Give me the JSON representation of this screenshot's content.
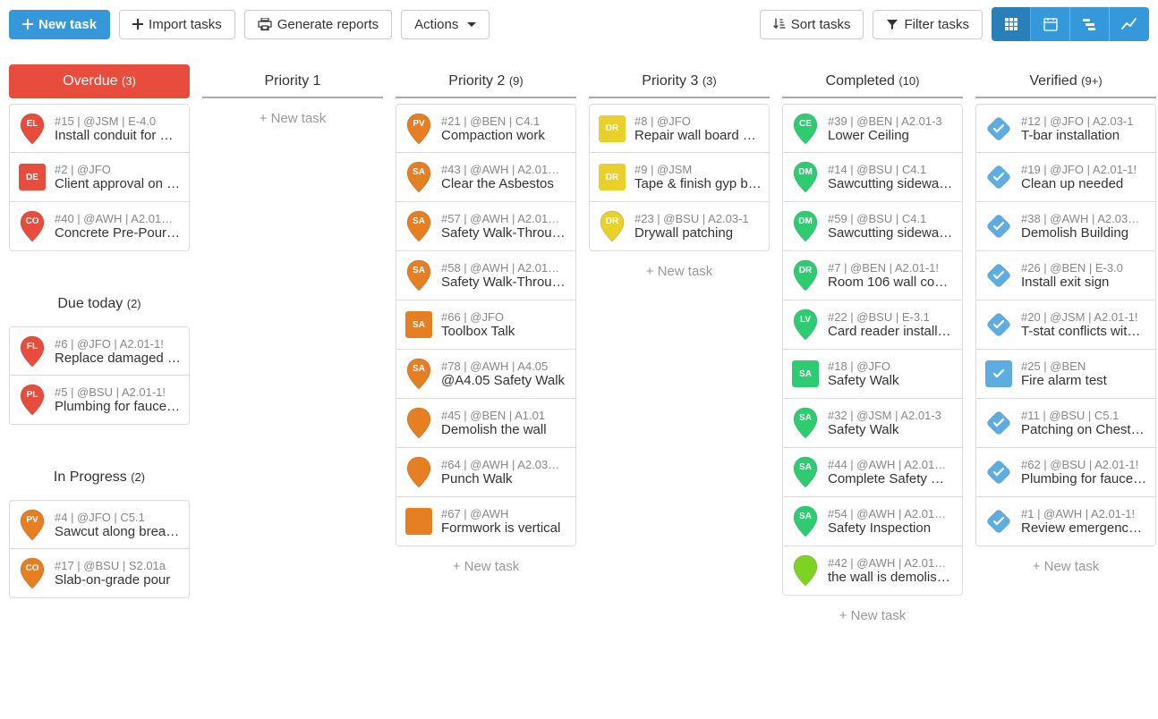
{
  "toolbar": {
    "new_task": "New task",
    "import_tasks": "Import tasks",
    "generate_reports": "Generate reports",
    "actions": "Actions",
    "sort_tasks": "Sort tasks",
    "filter_tasks": "Filter tasks"
  },
  "new_task_inline": "+ New task",
  "colors": {
    "red": "#e74c3c",
    "orange": "#e67e22",
    "yellow": "#e9d02b",
    "green": "#2ecc71",
    "lime": "#7ed321",
    "blue": "#5dade2",
    "blue2": "#5dade2"
  },
  "columns": [
    {
      "id": "overdue",
      "title": "Overdue",
      "count": "(3)",
      "header_style": "overdue",
      "groups": [
        {
          "cards": [
            {
              "shape": "pin",
              "color": "red",
              "badge": "EL",
              "meta": "#15 | @JSM | E-4.0",
              "title": "Install conduit for …"
            },
            {
              "shape": "square",
              "color": "red",
              "badge": "DE",
              "meta": "#2 | @JFO",
              "title": "Client approval on …"
            },
            {
              "shape": "pin",
              "color": "red",
              "badge": "CO",
              "meta": "#40 | @AWH | A2.01…",
              "title": "Concrete Pre-Pour…"
            }
          ]
        },
        {
          "title": "Due today",
          "count": "(2)",
          "cards": [
            {
              "shape": "pin",
              "color": "red",
              "badge": "FL",
              "meta": "#6 | @JFO | A2.01-1!",
              "title": "Replace damaged c…"
            },
            {
              "shape": "pin",
              "color": "red",
              "badge": "PL",
              "meta": "#5 | @BSU | A2.01-1!",
              "title": "Plumbing for fauce…"
            }
          ]
        },
        {
          "title": "In Progress",
          "count": "(2)",
          "cards": [
            {
              "shape": "pin",
              "color": "orange",
              "badge": "PV",
              "meta": "#4 | @JFO | C5.1",
              "title": "Sawcut along brea…"
            },
            {
              "shape": "pin",
              "color": "orange",
              "badge": "CO",
              "meta": "#17 | @BSU | S2.01a",
              "title": "Slab-on-grade pour"
            }
          ]
        }
      ]
    },
    {
      "id": "priority1",
      "title": "Priority 1",
      "count": "",
      "groups": [
        {
          "cards": []
        }
      ],
      "show_new_task_top": true
    },
    {
      "id": "priority2",
      "title": "Priority 2",
      "count": "(9)",
      "groups": [
        {
          "cards": [
            {
              "shape": "pin",
              "color": "orange",
              "badge": "PV",
              "meta": "#21 | @BEN | C4.1",
              "title": "Compaction work"
            },
            {
              "shape": "pin",
              "color": "orange",
              "badge": "SA",
              "meta": "#43 | @AWH | A2.01…",
              "title": "Clear the Asbestos"
            },
            {
              "shape": "pin",
              "color": "orange",
              "badge": "SA",
              "meta": "#57 | @AWH | A2.01…",
              "title": "Safety Walk-Throu…"
            },
            {
              "shape": "pin",
              "color": "orange",
              "badge": "SA",
              "meta": "#58 | @AWH | A2.01…",
              "title": "Safety Walk-Throu…"
            },
            {
              "shape": "square",
              "color": "orange",
              "badge": "SA",
              "meta": "#66 | @JFO",
              "title": "Toolbox Talk"
            },
            {
              "shape": "pin",
              "color": "orange",
              "badge": "SA",
              "meta": "#78 | @AWH | A4.05",
              "title": "@A4.05 Safety Walk"
            },
            {
              "shape": "pin",
              "color": "orange",
              "badge": "",
              "meta": "#45 | @BEN | A1.01",
              "title": "Demolish the wall"
            },
            {
              "shape": "pin",
              "color": "orange",
              "badge": "",
              "meta": "#64 | @AWH | A2.03…",
              "title": "Punch Walk"
            },
            {
              "shape": "square",
              "color": "orange",
              "badge": "",
              "meta": "#67 | @AWH",
              "title": "Formwork is vertical"
            }
          ]
        }
      ],
      "show_new_task_bottom": true
    },
    {
      "id": "priority3",
      "title": "Priority 3",
      "count": "(3)",
      "groups": [
        {
          "cards": [
            {
              "shape": "square",
              "color": "yellow",
              "badge": "DR",
              "meta": "#8 | @JFO",
              "title": "Repair wall board …"
            },
            {
              "shape": "square",
              "color": "yellow",
              "badge": "DR",
              "meta": "#9 | @JSM",
              "title": "Tape & finish gyp b…"
            },
            {
              "shape": "pin",
              "color": "yellow",
              "badge": "DR",
              "meta": "#23 | @BSU | A2.03-1",
              "title": "Drywall patching"
            }
          ]
        }
      ],
      "show_new_task_bottom": true
    },
    {
      "id": "completed",
      "title": "Completed",
      "count": "(10)",
      "groups": [
        {
          "cards": [
            {
              "shape": "pin",
              "color": "green",
              "badge": "CE",
              "meta": "#39 | @BEN | A2.01-3",
              "title": "Lower Ceiling"
            },
            {
              "shape": "pin",
              "color": "green",
              "badge": "DM",
              "meta": "#14 | @BSU | C4.1",
              "title": "Sawcutting sidewa…"
            },
            {
              "shape": "pin",
              "color": "green",
              "badge": "DM",
              "meta": "#59 | @BSU | C4.1",
              "title": "Sawcutting sidewa…"
            },
            {
              "shape": "pin",
              "color": "green",
              "badge": "DR",
              "meta": "#7 | @BEN | A2.01-1!",
              "title": "Room 106 wall co…"
            },
            {
              "shape": "pin",
              "color": "green",
              "badge": "LV",
              "meta": "#22 | @BSU | E-3.1",
              "title": "Card reader install…"
            },
            {
              "shape": "square",
              "color": "green",
              "badge": "SA",
              "meta": "#18 | @JFO",
              "title": "Safety Walk"
            },
            {
              "shape": "pin",
              "color": "green",
              "badge": "SA",
              "meta": "#32 | @JSM | A2.01-3",
              "title": "Safety Walk"
            },
            {
              "shape": "pin",
              "color": "green",
              "badge": "SA",
              "meta": "#44 | @AWH | A2.01…",
              "title": "Complete Safety …"
            },
            {
              "shape": "pin",
              "color": "green",
              "badge": "SA",
              "meta": "#54 | @AWH | A2.01…",
              "title": "Safety Inspection"
            },
            {
              "shape": "pin",
              "color": "lime",
              "badge": "",
              "meta": "#42 | @AWH | A2.01…",
              "title": "the wall is demolis…"
            }
          ]
        }
      ],
      "show_new_task_bottom": true
    },
    {
      "id": "verified",
      "title": "Verified",
      "count": "(9+)",
      "groups": [
        {
          "cards": [
            {
              "shape": "diamond",
              "color": "blue",
              "badge": "check",
              "meta": "#12 | @JFO | A2.03-1",
              "title": "T-bar installation"
            },
            {
              "shape": "diamond",
              "color": "blue",
              "badge": "check",
              "meta": "#19 | @JFO | A2.01-1!",
              "title": "Clean up needed"
            },
            {
              "shape": "diamond",
              "color": "blue",
              "badge": "check",
              "meta": "#38 | @AWH | A2.03…",
              "title": "Demolish Building"
            },
            {
              "shape": "diamond",
              "color": "blue",
              "badge": "check",
              "meta": "#26 | @BEN | E-3.0",
              "title": "Install exit sign"
            },
            {
              "shape": "diamond",
              "color": "blue",
              "badge": "check",
              "meta": "#20 | @JSM | A2.01-1!",
              "title": "T-stat conflicts wit…"
            },
            {
              "shape": "square",
              "color": "blue",
              "badge": "check",
              "meta": "#25 | @BEN",
              "title": "Fire alarm test"
            },
            {
              "shape": "diamond",
              "color": "blue",
              "badge": "check",
              "meta": "#11 | @BSU | C5.1",
              "title": "Patching on Chest…"
            },
            {
              "shape": "diamond",
              "color": "blue",
              "badge": "check",
              "meta": "#62 | @BSU | A2.01-1!",
              "title": "Plumbing for fauce…"
            },
            {
              "shape": "diamond",
              "color": "blue",
              "badge": "check",
              "meta": "#1 | @AWH | A2.01-1!",
              "title": "Review emergency…"
            }
          ]
        }
      ],
      "show_new_task_bottom": true
    }
  ]
}
